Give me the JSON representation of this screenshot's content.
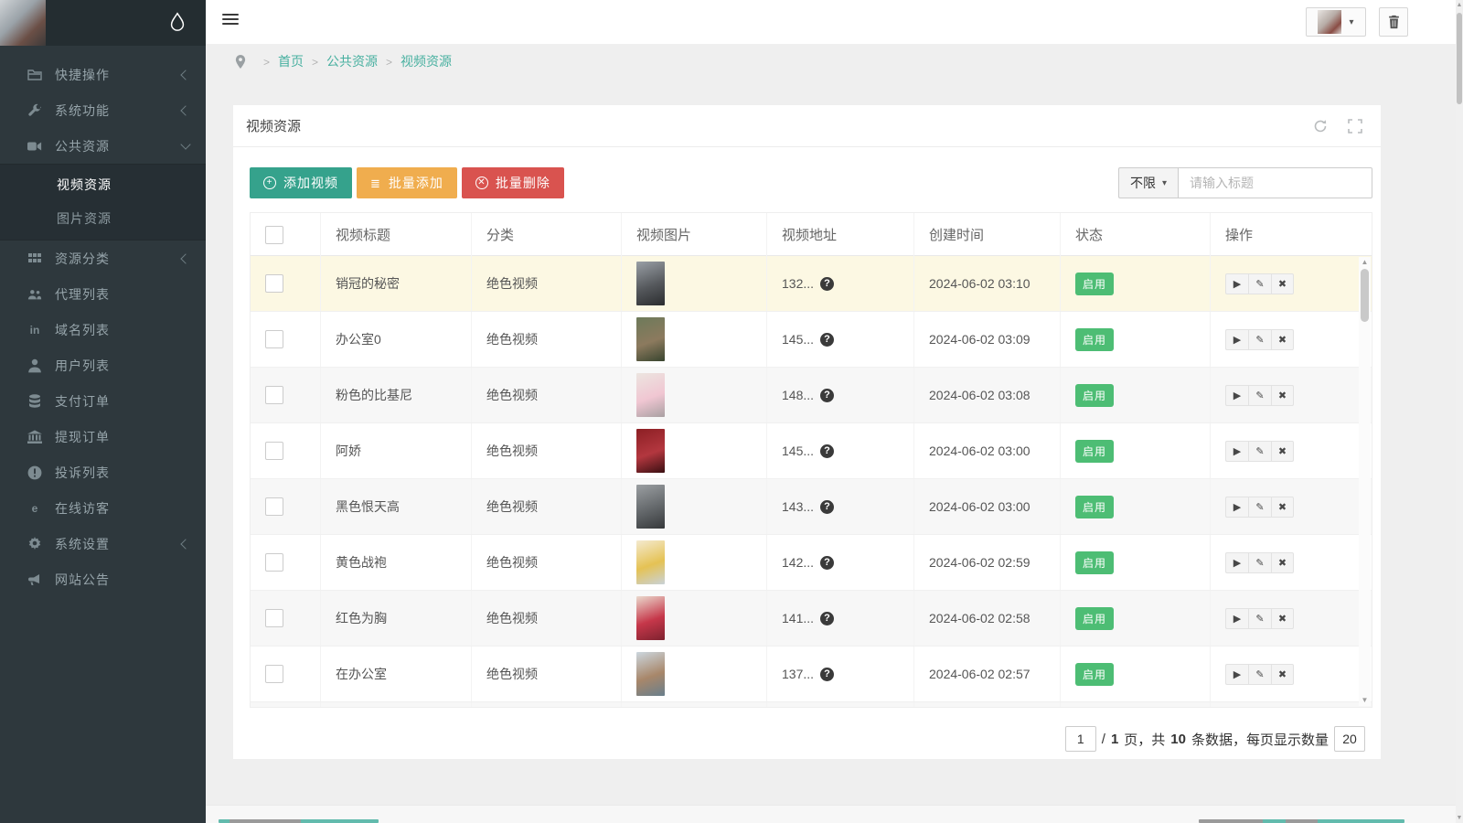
{
  "sidebar": {
    "items": [
      {
        "label": "快捷操作",
        "icon": "folder-icon",
        "chevron": "left"
      },
      {
        "label": "系统功能",
        "icon": "wrench-icon",
        "chevron": "left"
      },
      {
        "label": "公共资源",
        "icon": "video-icon",
        "chevron": "down",
        "submenu": [
          {
            "label": "视频资源",
            "active": true
          },
          {
            "label": "图片资源",
            "active": false
          }
        ]
      },
      {
        "label": "资源分类",
        "icon": "grid-icon",
        "chevron": "left"
      },
      {
        "label": "代理列表",
        "icon": "users-icon"
      },
      {
        "label": "域名列表",
        "icon": "linkedin-icon"
      },
      {
        "label": "用户列表",
        "icon": "user-icon"
      },
      {
        "label": "支付订单",
        "icon": "database-icon"
      },
      {
        "label": "提现订单",
        "icon": "bank-icon"
      },
      {
        "label": "投诉列表",
        "icon": "warning-icon"
      },
      {
        "label": "在线访客",
        "icon": "edge-icon"
      },
      {
        "label": "系统设置",
        "icon": "gear-icon",
        "chevron": "left"
      },
      {
        "label": "网站公告",
        "icon": "megaphone-icon"
      }
    ]
  },
  "breadcrumb": {
    "items": [
      "首页",
      "公共资源",
      "视频资源"
    ]
  },
  "panel": {
    "title": "视频资源"
  },
  "toolbar": {
    "add_video": "添加视频",
    "batch_add": "批量添加",
    "batch_delete": "批量删除",
    "filter_label": "不限",
    "search_placeholder": "请输入标题"
  },
  "table": {
    "headers": [
      "视频标题",
      "分类",
      "视频图片",
      "视频地址",
      "创建时间",
      "状态",
      "操作"
    ],
    "rows": [
      {
        "title": "销冠的秘密",
        "category": "绝色视频",
        "address": "132...",
        "time": "2024-06-02 03:10",
        "status": "启用",
        "highlight": true,
        "thumb": [
          "#9aa0a6",
          "#55585c",
          "#2b2d2f"
        ]
      },
      {
        "title": "办公室0",
        "category": "绝色视频",
        "address": "145...",
        "time": "2024-06-02 03:09",
        "status": "启用",
        "highlight": false,
        "thumb": [
          "#6d7a5a",
          "#8c7a5e",
          "#39452f"
        ]
      },
      {
        "title": "粉色的比基尼",
        "category": "绝色视频",
        "address": "148...",
        "time": "2024-06-02 03:08",
        "status": "启用",
        "highlight": false,
        "thumb": [
          "#ece5e0",
          "#f0c6d2",
          "#a9a0a2"
        ]
      },
      {
        "title": "阿娇",
        "category": "绝色视频",
        "address": "145...",
        "time": "2024-06-02 03:00",
        "status": "启用",
        "highlight": false,
        "thumb": [
          "#8c1f24",
          "#b3373f",
          "#3a0f12"
        ]
      },
      {
        "title": "黑色恨天高",
        "category": "绝色视频",
        "address": "143...",
        "time": "2024-06-02 03:00",
        "status": "启用",
        "highlight": false,
        "thumb": [
          "#9b9fa2",
          "#63676a",
          "#36393b"
        ]
      },
      {
        "title": "黄色战袍",
        "category": "绝色视频",
        "address": "142...",
        "time": "2024-06-02 02:59",
        "status": "启用",
        "highlight": false,
        "thumb": [
          "#f4ead0",
          "#e5c254",
          "#c9d2d8"
        ]
      },
      {
        "title": "红色为胸",
        "category": "绝色视频",
        "address": "141...",
        "time": "2024-06-02 02:58",
        "status": "启用",
        "highlight": false,
        "thumb": [
          "#ead9cd",
          "#c6374a",
          "#7e222f"
        ]
      },
      {
        "title": "在办公室",
        "category": "绝色视频",
        "address": "137...",
        "time": "2024-06-02 02:57",
        "status": "启用",
        "highlight": false,
        "thumb": [
          "#ccd7df",
          "#a8876a",
          "#697f8c"
        ]
      },
      {
        "title": "",
        "category": "",
        "address": "",
        "time": "",
        "status": "",
        "highlight": false,
        "thumb": [
          "#d9d3c9",
          "#9aa4ae",
          "#6b707a"
        ]
      }
    ]
  },
  "pagination": {
    "page": "1",
    "sep": "/",
    "page_total": "1",
    "label_page": "页，共",
    "total": "10",
    "label_tail": "条数据，每页显示数量",
    "per_page": "20"
  },
  "colors": {
    "accent_teal": "#35a28c",
    "link_teal": "#48b0a0",
    "warning_orange": "#f0ad4e",
    "danger_red": "#d9534f",
    "badge_green": "#4dbd74",
    "highlight_row": "#fcf8e3"
  }
}
